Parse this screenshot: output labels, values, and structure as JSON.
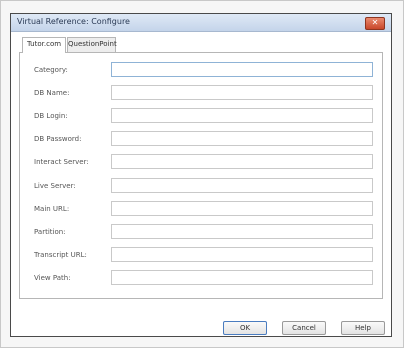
{
  "window": {
    "title": "Virtual Reference: Configure",
    "close_label": "✕"
  },
  "tabs": [
    {
      "label": "Tutor.com"
    },
    {
      "label": "QuestionPoint"
    }
  ],
  "form": {
    "fields": [
      {
        "label": "Category:",
        "value": ""
      },
      {
        "label": "DB Name:",
        "value": ""
      },
      {
        "label": "DB Login:",
        "value": ""
      },
      {
        "label": "DB Password:",
        "value": ""
      },
      {
        "label": "Interact Server:",
        "value": ""
      },
      {
        "label": "Live Server:",
        "value": ""
      },
      {
        "label": "Main URL:",
        "value": ""
      },
      {
        "label": "Partition:",
        "value": ""
      },
      {
        "label": "Transcript URL:",
        "value": ""
      },
      {
        "label": "View Path:",
        "value": ""
      }
    ]
  },
  "buttons": {
    "ok": "OK",
    "cancel": "Cancel",
    "help": "Help"
  }
}
